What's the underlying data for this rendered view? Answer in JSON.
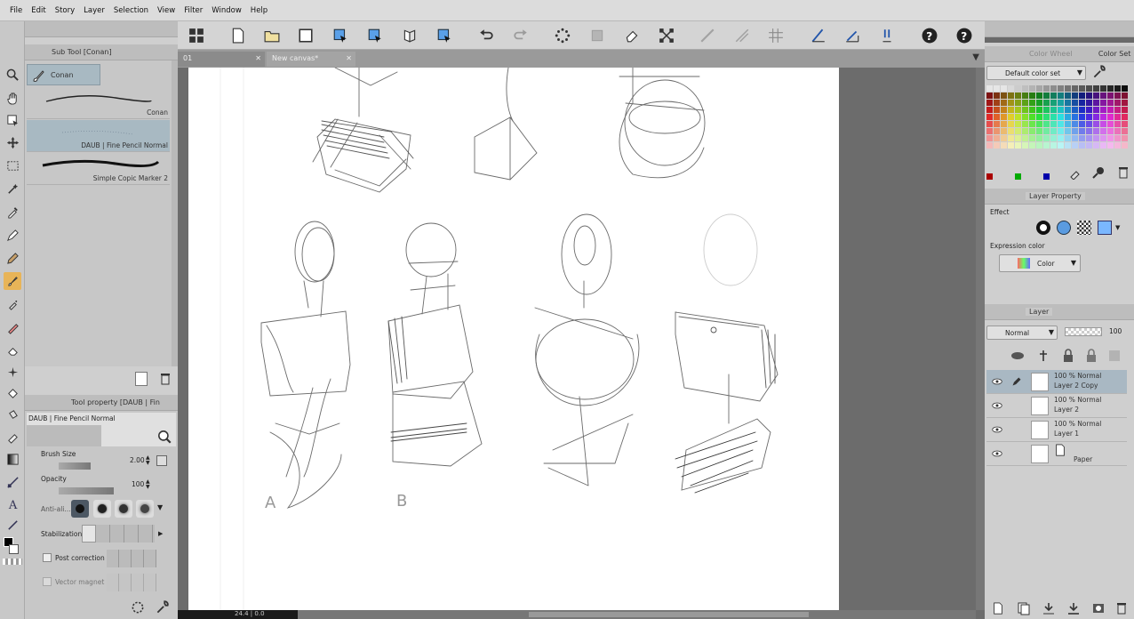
{
  "menu": [
    "File",
    "Edit",
    "Story",
    "Layer",
    "Selection",
    "View",
    "Filter",
    "Window",
    "Help"
  ],
  "subtool": {
    "title": "Sub Tool [Conan]",
    "group": "Conan",
    "brushes": [
      "Conan",
      "DAUB | Fine Pencil Normal",
      "Simple Copic Marker 2"
    ]
  },
  "toolprop": {
    "title": "Tool property [DAUB | Fin",
    "preset": "DAUB | Fine Pencil Normal",
    "brush_size_label": "Brush Size",
    "brush_size": "2.00",
    "opacity_label": "Opacity",
    "opacity": "100",
    "antialias_label": "Anti-ali...",
    "stabilization_label": "Stabilization",
    "post_correction_label": "Post correction",
    "vector_magnet_label": "Vector magnet"
  },
  "tabs": [
    "01",
    "New canvas*"
  ],
  "canvas": {
    "letters": [
      "A",
      "B"
    ]
  },
  "status": {
    "coords": "24.4 | 0.0"
  },
  "color": {
    "tabs": [
      "Color Wheel",
      "Color Set"
    ],
    "set_name": "Default color set",
    "palette": [
      "#ffffff",
      "#000000",
      "#ff0000",
      "#00ff00",
      "#0000ff",
      "#ffff00",
      "#ff00ff",
      "#00ffff",
      "#808080",
      "#c0c0c0"
    ]
  },
  "layer_property": {
    "title": "Layer Property",
    "effect_label": "Effect",
    "expr_label": "Expression color",
    "expr_value": "Color"
  },
  "layers": {
    "title": "Layer",
    "blend": "Normal",
    "opacity": "100",
    "items": [
      {
        "info": "100 %  Normal",
        "name": "Layer 2 Copy"
      },
      {
        "info": "100 %  Normal",
        "name": "Layer 2"
      },
      {
        "info": "100 %  Normal",
        "name": "Layer 1"
      },
      {
        "info": "",
        "name": "Paper"
      }
    ]
  }
}
